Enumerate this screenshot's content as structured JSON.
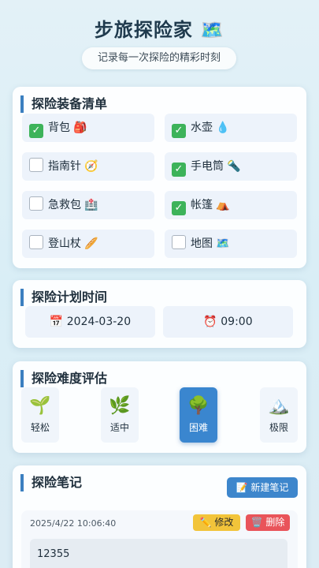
{
  "header": {
    "title": "步旅探险家 🗺️",
    "subtitle": "记录每一次探险的精彩时刻"
  },
  "equipment": {
    "title": "探险装备清单",
    "items": [
      {
        "label": "背包",
        "emoji": "🎒",
        "checked": true
      },
      {
        "label": "水壶",
        "emoji": "💧",
        "checked": true
      },
      {
        "label": "指南针",
        "emoji": "🧭",
        "checked": false
      },
      {
        "label": "手电筒",
        "emoji": "🔦",
        "checked": true
      },
      {
        "label": "急救包",
        "emoji": "🏥",
        "checked": false
      },
      {
        "label": "帐篷",
        "emoji": "⛺",
        "checked": true
      },
      {
        "label": "登山杖",
        "emoji": "🥖",
        "checked": false
      },
      {
        "label": "地图",
        "emoji": "🗺️",
        "checked": false
      }
    ]
  },
  "schedule": {
    "title": "探险计划时间",
    "date_icon": "📅",
    "date": "2024-03-20",
    "time_icon": "⏰",
    "time": "09:00"
  },
  "difficulty": {
    "title": "探险难度评估",
    "levels": [
      {
        "label": "轻松",
        "icon": "🌱",
        "selected": false
      },
      {
        "label": "适中",
        "icon": "🌿",
        "selected": false
      },
      {
        "label": "困难",
        "icon": "🌳",
        "selected": true
      },
      {
        "label": "极限",
        "icon": "🏔️",
        "selected": false
      }
    ]
  },
  "notes": {
    "title": "探险笔记",
    "new_button": "📝 新建笔记",
    "entries": [
      {
        "timestamp": "2025/4/22 10:06:40",
        "edit_label": "✏️ 修改",
        "delete_label": "🗑️ 删除",
        "content": "12355"
      }
    ]
  },
  "colors": {
    "accent": "#3b7fc0",
    "checked": "#3db35a",
    "edit": "#f2c43a",
    "delete": "#e9545a"
  }
}
